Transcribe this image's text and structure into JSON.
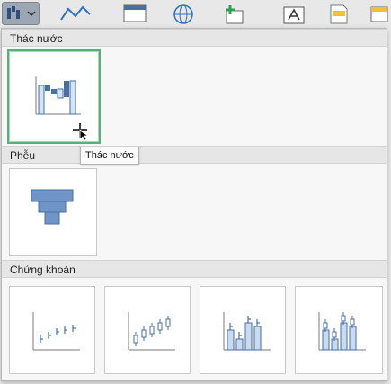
{
  "gallery": {
    "sections": [
      {
        "title": "Thác nước"
      },
      {
        "title": "Phễu"
      },
      {
        "title": "Chứng khoán"
      }
    ]
  },
  "tooltip": {
    "text": "Thác nước"
  }
}
